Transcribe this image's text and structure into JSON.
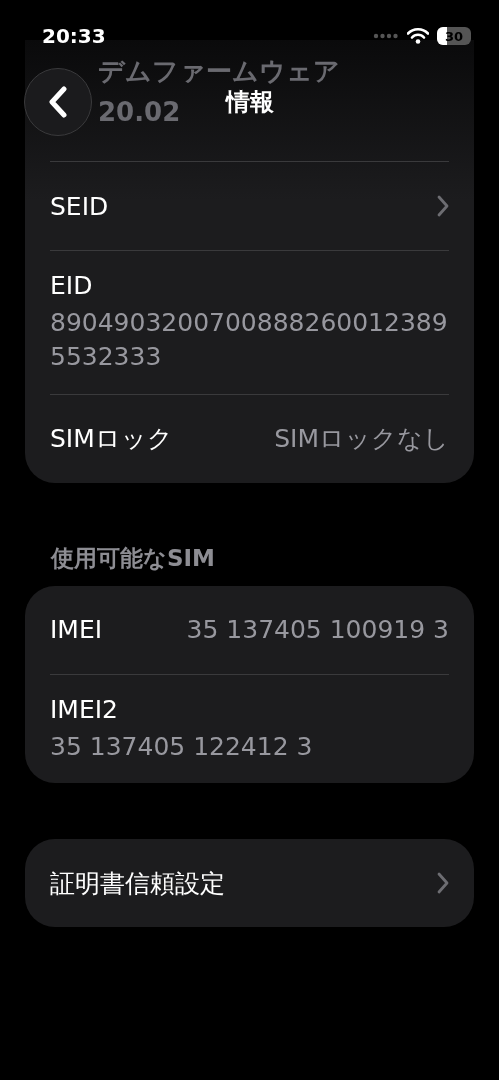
{
  "status_bar": {
    "time": "20:33",
    "battery": "30"
  },
  "nav": {
    "title": "情報"
  },
  "groups": [
    {
      "rows": [
        {
          "kind": "faded",
          "label": "デムファームウェア",
          "value": "20.02"
        },
        {
          "kind": "link",
          "label": "SEID"
        },
        {
          "kind": "stacked",
          "label": "EID",
          "value": "89049032007008882600123895532333"
        },
        {
          "kind": "inline",
          "label": "SIMロック",
          "value": "SIMロックなし"
        }
      ]
    },
    {
      "header": "使用可能なSIM",
      "rows": [
        {
          "kind": "inline",
          "label": "IMEI",
          "value": "35 137405 100919 3"
        },
        {
          "kind": "stacked",
          "label": "IMEI2",
          "value": "35 137405 122412 3"
        }
      ]
    },
    {
      "rows": [
        {
          "kind": "link",
          "label": "証明書信頼設定"
        }
      ]
    }
  ]
}
